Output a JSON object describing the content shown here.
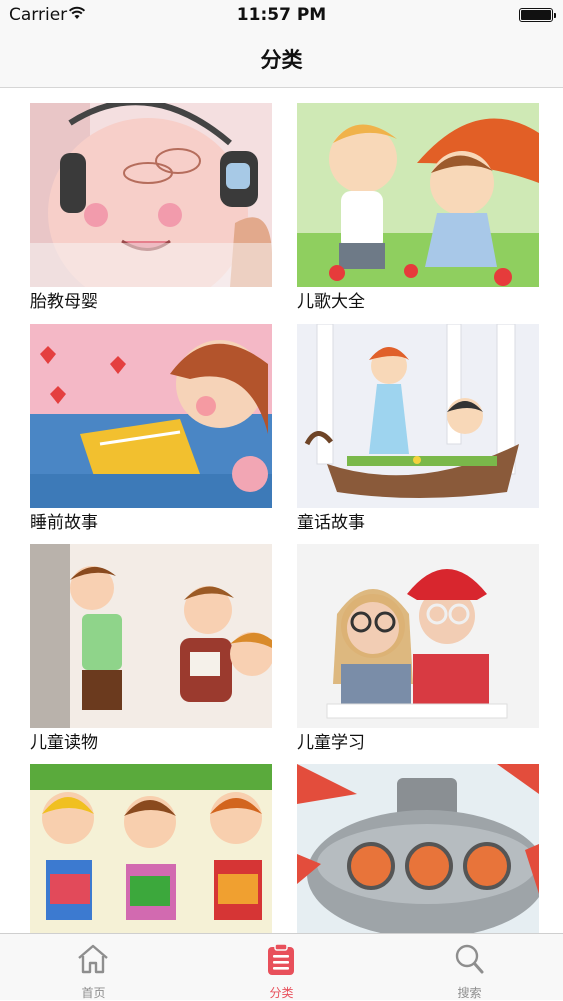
{
  "status_bar": {
    "carrier": "Carrier",
    "time": "11:57 PM"
  },
  "nav": {
    "title": "分类"
  },
  "categories": [
    {
      "label": "胎教母婴",
      "image": "baby-bump-headphones"
    },
    {
      "label": "儿歌大全",
      "image": "kids-umbrella"
    },
    {
      "label": "睡前故事",
      "image": "girl-sleeping-book"
    },
    {
      "label": "童话故事",
      "image": "fairy-boat"
    },
    {
      "label": "儿童读物",
      "image": "kids-playing"
    },
    {
      "label": "儿童学习",
      "image": "two-girls-glasses"
    },
    {
      "label": "",
      "image": "kids-reading"
    },
    {
      "label": "",
      "image": "cartoon-submarine"
    }
  ],
  "tabbar": {
    "items": [
      {
        "label": "首页",
        "icon": "home-icon"
      },
      {
        "label": "分类",
        "icon": "list-icon",
        "active": true
      },
      {
        "label": "搜索",
        "icon": "search-icon"
      }
    ]
  },
  "colors": {
    "accent": "#e8505b",
    "inactive": "#8e8e8e",
    "bar_bg": "#f8f8f8"
  }
}
